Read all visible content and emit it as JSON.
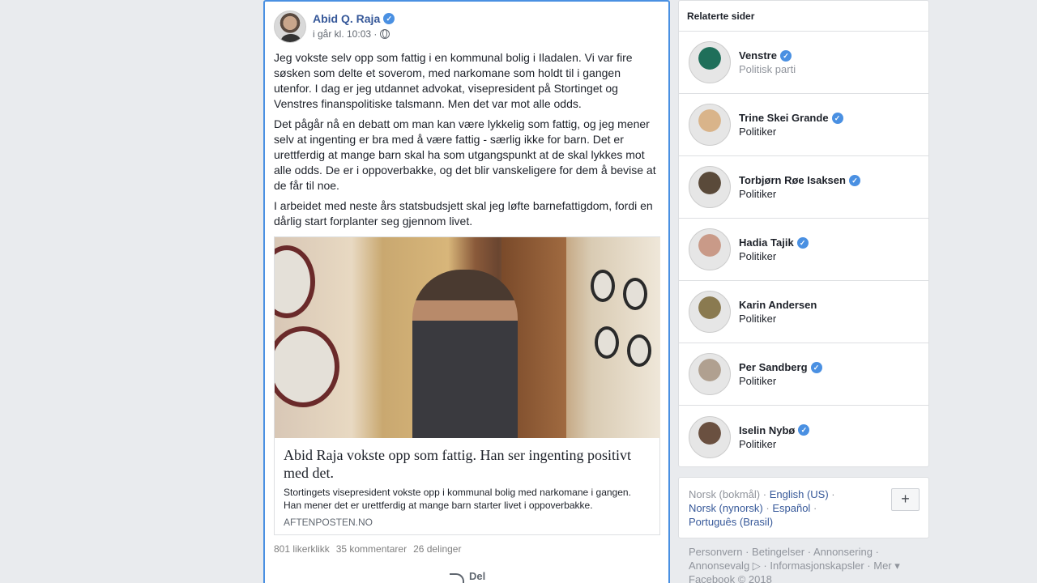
{
  "post": {
    "author": "Abid Q. Raja",
    "timestamp": "i går kl. 10:03 ·",
    "paragraphs": [
      "Jeg vokste selv opp som fattig i en kommunal bolig i Iladalen. Vi var fire søsken som delte et soverom, med narkomane som holdt til i gangen utenfor. I dag er jeg utdannet advokat, visepresident på Stortinget og Venstres finanspolitiske talsmann. Men det var mot alle odds.",
      "Det pågår nå en debatt om man kan være lykkelig som fattig, og jeg mener selv at ingenting er bra med å være fattig - særlig ikke for barn. Det er urettferdig at mange barn skal ha som utgangspunkt at de skal lykkes mot alle odds. De er i oppoverbakke, og det blir vanskeligere for dem å bevise at de får til noe.",
      "I arbeidet med neste års statsbudsjett skal jeg løfte barnefattigdom, fordi en dårlig start forplanter seg gjennom livet."
    ],
    "link": {
      "title": "Abid Raja vokste opp som fattig. Han ser ingenting positivt med det.",
      "description": "Stortingets visepresident vokste opp i kommunal bolig med narkomane i gangen. Han mener det er urettferdig at mange barn starter livet i oppoverbakke.",
      "domain": "AFTENPOSTEN.NO"
    },
    "stats": {
      "likes": "801 likerklikk",
      "comments": "35 kommentarer",
      "shares": "26 delinger"
    },
    "share_label": "Del"
  },
  "related": {
    "header": "Relaterte sider",
    "items": [
      {
        "name": "Venstre",
        "sub": "Politisk parti",
        "verified": true,
        "muted": true,
        "color": "#1f6f5a"
      },
      {
        "name": "Trine Skei Grande",
        "sub": "Politiker",
        "verified": true,
        "muted": false,
        "color": "#d9b48a"
      },
      {
        "name": "Torbjørn Røe Isaksen",
        "sub": "Politiker",
        "verified": true,
        "muted": false,
        "color": "#5a4a3a"
      },
      {
        "name": "Hadia Tajik",
        "sub": "Politiker",
        "verified": true,
        "muted": false,
        "color": "#c99a88"
      },
      {
        "name": "Karin Andersen",
        "sub": "Politiker",
        "verified": false,
        "muted": false,
        "color": "#8a7a50"
      },
      {
        "name": "Per Sandberg",
        "sub": "Politiker",
        "verified": true,
        "muted": false,
        "color": "#b0a090"
      },
      {
        "name": "Iselin Nybø",
        "sub": "Politiker",
        "verified": true,
        "muted": false,
        "color": "#6a5040"
      }
    ]
  },
  "languages": {
    "current": "Norsk (bokmål)",
    "others": [
      "English (US)",
      "Norsk (nynorsk)",
      "Español",
      "Português (Brasil)"
    ],
    "add_label": "+"
  },
  "footer": {
    "links": [
      "Personvern",
      "Betingelser",
      "Annonsering",
      "Annonsevalg",
      "Informasjonskapsler",
      "Mer"
    ],
    "copyright": "Facebook © 2018"
  }
}
